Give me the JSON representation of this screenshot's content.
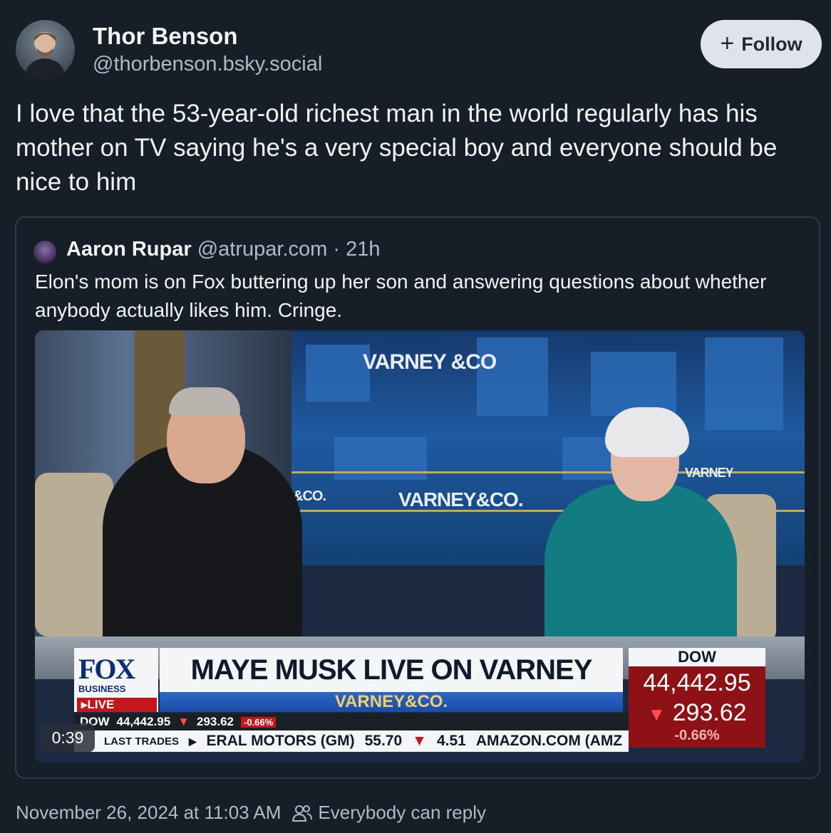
{
  "post": {
    "author_name": "Thor Benson",
    "author_handle": "@thorbenson.bsky.social",
    "follow_label": "Follow",
    "text": "I love that the 53-year-old richest man in the world regularly has his mother on TV saying he's a very special boy and everyone should be nice to him",
    "timestamp": "November 26, 2024 at 11:03 AM",
    "reply_setting": "Everybody can reply"
  },
  "quoted": {
    "author_name": "Aaron Rupar",
    "author_handle": "@atrupar.com",
    "separator": "·",
    "age": "21h",
    "text": "Elon's mom is on Fox buttering up her son and answering questions about whether anybody actually likes him. Cringe.",
    "video": {
      "duration": "0:39",
      "studio_logos": [
        "VARNEY &CO",
        "VARNEY&CO.",
        "&CO.",
        "VARNEY"
      ],
      "network": "FOX",
      "network_sub": "BUSINESS",
      "live_tag": "LIVE",
      "headline": "MAYE MUSK LIVE ON VARNEY",
      "show_name": "VARNEY&CO.",
      "dow_label": "DOW",
      "dow_value": "44,442.95",
      "dow_change": "293.62",
      "dow_pct": "-0.66%",
      "ticker_top_label": "DOW",
      "ticker_top_value": "44,442.95",
      "ticker_top_change": "293.62",
      "ticker_top_pct": "-0.66%",
      "ticker_bottom_label": "LAST TRADES",
      "ticker_bottom_1": "ERAL MOTORS (GM)",
      "ticker_bottom_1_price": "55.70",
      "ticker_bottom_1_change": "4.51",
      "ticker_bottom_2": "AMAZON.COM (AMZ"
    }
  },
  "icons": {
    "follow": "plus-icon",
    "reply_setting": "people-icon",
    "ticker_down": "triangle-down-icon"
  },
  "colors": {
    "background": "#161e27",
    "text_primary": "#f1f3f5",
    "text_secondary": "#aebbc9",
    "follow_bg": "#dfe4ea",
    "fox_red": "#c4161c",
    "fox_blue": "#0c2f74"
  }
}
